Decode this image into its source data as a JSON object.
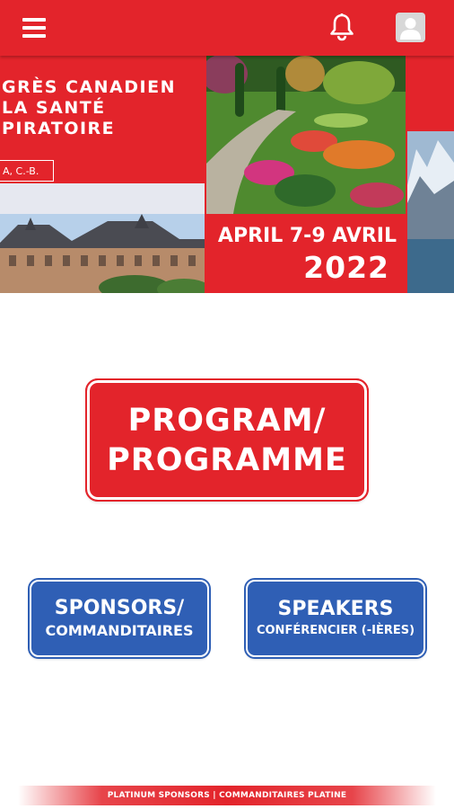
{
  "colors": {
    "brand_red": "#e3242b",
    "brand_blue": "#2f5fb5"
  },
  "icons": {
    "menu": "hamburger-menu-icon",
    "notifications": "bell-icon",
    "profile": "user-avatar-icon"
  },
  "banner": {
    "title_lines": [
      "GRÈS CANADIEN",
      "LA SANTÉ",
      "PIRATOIRE"
    ],
    "location": "A, C.-B.",
    "date_line": "APRIL 7-9 AVRIL",
    "year": "2022"
  },
  "buttons": {
    "program_line1": "PROGRAM/",
    "program_line2": "PROGRAMME",
    "sponsors_line1": "SPONSORS/",
    "sponsors_line2": "COMMANDITAIRES",
    "speakers_line1": "SPEAKERS",
    "speakers_line2": "CONFÉRENCIER (-IÈRES)"
  },
  "footer": {
    "sponsor_strip": "PLATINUM SPONSORS | COMMANDITAIRES PLATINE"
  }
}
